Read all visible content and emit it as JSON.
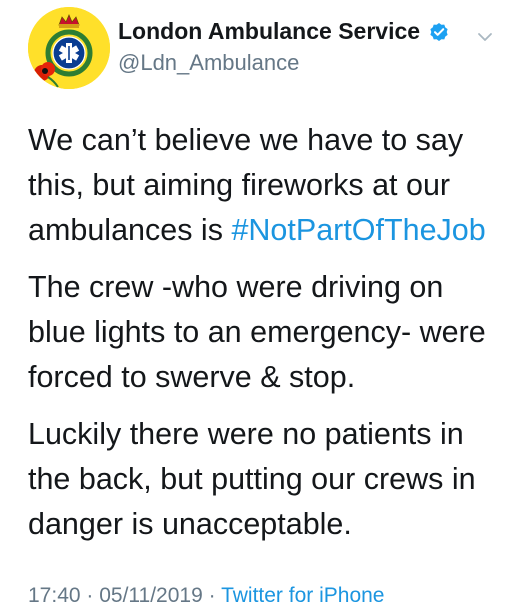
{
  "account": {
    "display_name": "London Ambulance Service",
    "handle": "@Ldn_Ambulance",
    "verified": true,
    "avatar_icon": "london-ambulance-crest-logo",
    "avatar_color": "#ffe02a"
  },
  "tweet": {
    "para1_prefix": "We can’t believe we have to say this, but aiming fireworks at our ambulances is ",
    "hashtag": "#NotPartOfTheJob",
    "para2": "The crew -who were driving on blue lights to an emergency- were forced to swerve & stop.",
    "para3": "Luckily there were no patients in the back, but putting our crews in danger is unacceptable."
  },
  "meta": {
    "time": "17:40",
    "date": "05/11/2019",
    "source": "Twitter for iPhone"
  },
  "colors": {
    "link": "#1b95e0",
    "secondary": "#657786",
    "verified_badge": "#1da1f2"
  },
  "icons": {
    "verified": "verified-badge-icon",
    "menu": "chevron-down-icon"
  }
}
